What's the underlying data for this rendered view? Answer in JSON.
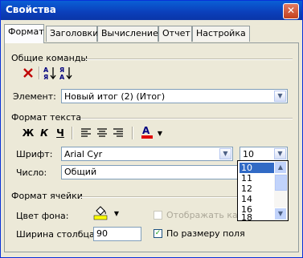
{
  "window": {
    "title": "Свойства",
    "close_glyph": "✕"
  },
  "tabs": [
    "Формат",
    "Заголовки",
    "Вычисление",
    "Отчет",
    "Настройка"
  ],
  "general_commands": {
    "heading": "Общие команды",
    "element_label": "Элемент:",
    "element_value": "Новый итог (2) (Итог)"
  },
  "text_format": {
    "heading": "Формат текста",
    "bold": "Ж",
    "italic": "К",
    "underline": "Ч",
    "font_label": "Шрифт:",
    "font_value": "Arial Cyr",
    "size_value": "10",
    "number_label": "Число:",
    "number_value": "Общий"
  },
  "size_list": {
    "options": [
      "10",
      "11",
      "12",
      "14",
      "16",
      "18"
    ],
    "selected": "10"
  },
  "cell_format": {
    "heading": "Формат ячейки",
    "bg_color_label": "Цвет фона:",
    "display_as_label": "Отображать как",
    "column_width_label": "Ширина столбца:",
    "column_width_value": "90",
    "fit_size_label": "По размеру поля",
    "fit_size_checked": true,
    "display_as_checked": false
  },
  "colors": {
    "accent_blue": "#0a5fd6",
    "font_color": "#e00000",
    "fill_color": "#ffff00",
    "delete_red": "#c00000"
  }
}
